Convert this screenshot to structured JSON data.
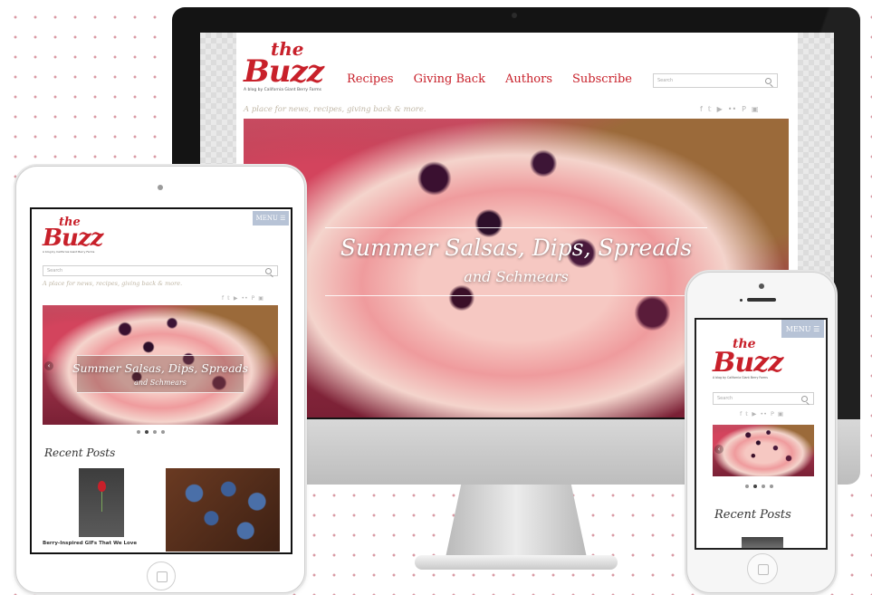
{
  "site": {
    "logo_the": "the",
    "logo_buzz": "Buzz",
    "logo_tagline": "A blog by California Giant Berry Farms",
    "tagline": "A place for news, recipes, giving back & more.",
    "search_placeholder": "Search",
    "menu_label": "MENU ☰",
    "nav": [
      {
        "label": "Recipes"
      },
      {
        "label": "Giving Back"
      },
      {
        "label": "Authors"
      },
      {
        "label": "Subscribe"
      }
    ],
    "social_icons": [
      "facebook-icon",
      "twitter-icon",
      "youtube-icon",
      "flickr-icon",
      "pinterest-icon",
      "instagram-icon"
    ],
    "social_glyphs": [
      "f",
      "𝕥",
      "▶",
      "••",
      "P",
      "▣"
    ],
    "hero": {
      "title": "Summer Salsas, Dips, Spreads",
      "subtitle": "and Schmears"
    },
    "recent_posts_title": "Recent Posts",
    "posts": [
      {
        "title": "Berry-Inspired GIFs That We Love"
      }
    ],
    "carousel": {
      "count": 4,
      "active_index": 1
    },
    "brand_color": "#c8202a"
  },
  "devices": {
    "desktop_logo_glyph": ""
  }
}
